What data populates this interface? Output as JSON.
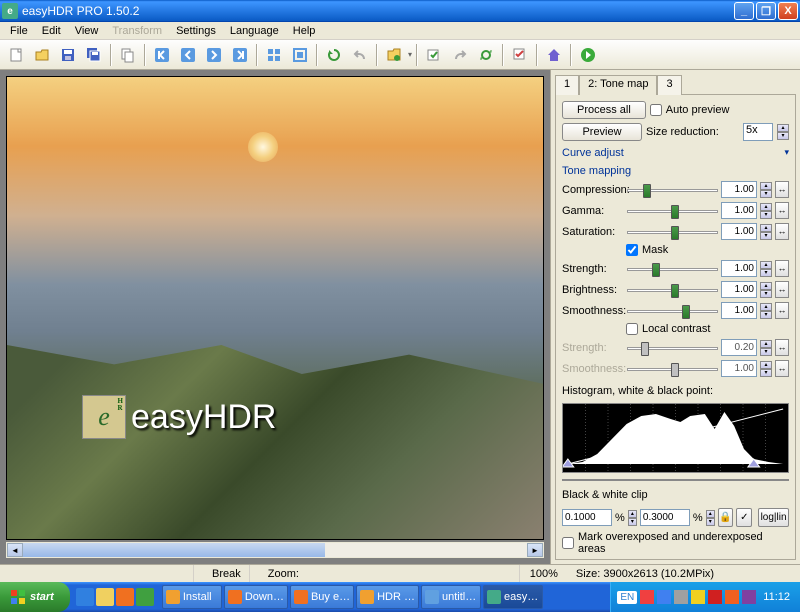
{
  "window": {
    "title": "easyHDR PRO 1.50.2"
  },
  "menu": {
    "file": "File",
    "edit": "Edit",
    "view": "View",
    "transform": "Transform",
    "settings": "Settings",
    "language": "Language",
    "help": "Help"
  },
  "logo": {
    "text": "easyHDR",
    "icon_e": "e"
  },
  "tabs": {
    "t1": "1",
    "t2": "2: Tone map",
    "t3": "3"
  },
  "buttons": {
    "process_all": "Process all",
    "preview": "Preview"
  },
  "labels": {
    "auto_preview": "Auto preview",
    "size_reduction": "Size reduction:",
    "size_val": "5x",
    "curve_adjust": "Curve adjust",
    "tone_mapping": "Tone mapping",
    "compression": "Compression:",
    "gamma": "Gamma:",
    "saturation": "Saturation:",
    "mask": "Mask",
    "strength": "Strength:",
    "brightness": "Brightness:",
    "smoothness": "Smoothness:",
    "local_contrast": "Local contrast",
    "strength2": "Strength:",
    "smoothness2": "Smoothness:",
    "histogram": "Histogram, white & black point:",
    "bw_clip": "Black & white clip",
    "mark_clip": "Mark overexposed and underexposed areas",
    "loglin": "log|lin",
    "lock": "🔒",
    "check": "✓"
  },
  "values": {
    "compression": "1.00",
    "gamma": "1.00",
    "saturation": "1.00",
    "strength": "1.00",
    "brightness": "1.00",
    "smoothness": "1.00",
    "strength2": "0.20",
    "smoothness2": "1.00",
    "black_clip": "0.1000",
    "white_clip": "0.3000",
    "pct": "%"
  },
  "status": {
    "break": "Break",
    "zoom": "Zoom:",
    "pct": "100%",
    "size": "Size: 3900x2613 (10.2MPix)"
  },
  "taskbar": {
    "start": "start",
    "lang": "EN",
    "clock": "11:12",
    "tasks": [
      {
        "label": "Install"
      },
      {
        "label": "Down…"
      },
      {
        "label": "Buy e…"
      },
      {
        "label": "HDR …"
      },
      {
        "label": "untitl…"
      },
      {
        "label": "easy…"
      }
    ]
  }
}
